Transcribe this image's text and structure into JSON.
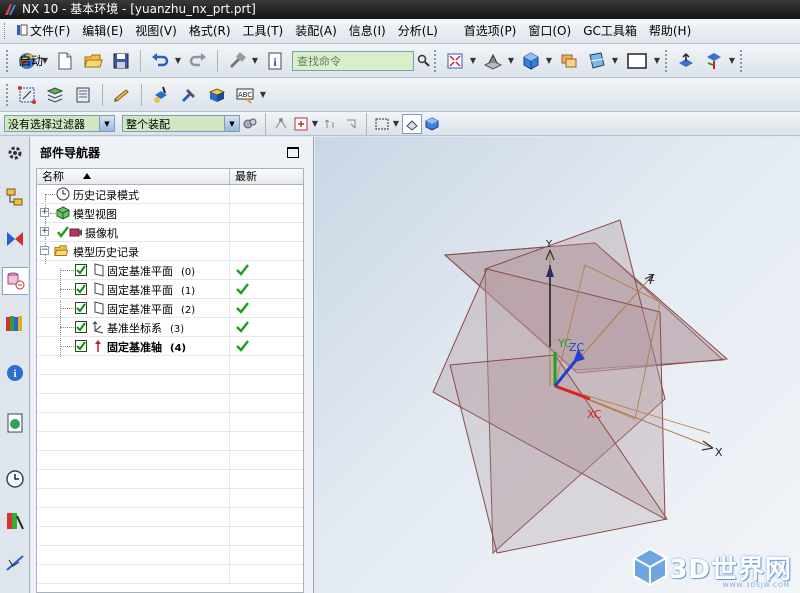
{
  "window": {
    "title": "NX 10 - 基本环境 - [yuanzhu_nx_prt.prt]"
  },
  "menu": {
    "items": [
      {
        "label": "文件(F)"
      },
      {
        "label": "编辑(E)"
      },
      {
        "label": "视图(V)"
      },
      {
        "label": "格式(R)"
      },
      {
        "label": "工具(T)"
      },
      {
        "label": "装配(A)"
      },
      {
        "label": "信息(I)"
      },
      {
        "label": "分析(L)"
      },
      {
        "label": "首选项(P)"
      },
      {
        "label": "窗口(O)"
      },
      {
        "label": "GC工具箱"
      },
      {
        "label": "帮助(H)"
      }
    ]
  },
  "toolbar": {
    "start_label": "启动",
    "search_placeholder": "查找命令"
  },
  "selection_bar": {
    "filter_value": "没有选择过滤器",
    "scope_value": "整个装配"
  },
  "navigator": {
    "title": "部件导航器",
    "columns": {
      "name": "名称",
      "latest": "最新"
    },
    "rows": [
      {
        "label": "历史记录模式",
        "index": "",
        "latest": false,
        "checked": false
      },
      {
        "label": "模型视图",
        "index": "",
        "latest": false,
        "checked": false
      },
      {
        "label": "摄像机",
        "index": "",
        "latest": false,
        "checked": false
      },
      {
        "label": "模型历史记录",
        "index": "",
        "latest": false,
        "checked": false
      },
      {
        "label": "固定基准平面",
        "index": "(0)",
        "latest": true,
        "checked": true
      },
      {
        "label": "固定基准平面",
        "index": "(1)",
        "latest": true,
        "checked": true
      },
      {
        "label": "固定基准平面",
        "index": "(2)",
        "latest": true,
        "checked": true
      },
      {
        "label": "基准坐标系",
        "index": "(3)",
        "latest": true,
        "checked": true
      },
      {
        "label": "固定基准轴",
        "index": "(4)",
        "latest": true,
        "checked": true
      }
    ]
  },
  "viewport": {
    "axis_labels": {
      "x": "X",
      "y": "Y",
      "z": "Z",
      "xc": "XC",
      "yc": "YC",
      "zc": "ZC"
    },
    "colors": {
      "plane_fill": "#b59aa0",
      "plane_edge": "#8a4a4a",
      "x_axis": "#e02020",
      "y_axis": "#20a020",
      "z_axis": "#2040d0"
    }
  },
  "watermark": {
    "text": "3D世界网",
    "sub": "WWW.3DSJW.COM"
  }
}
